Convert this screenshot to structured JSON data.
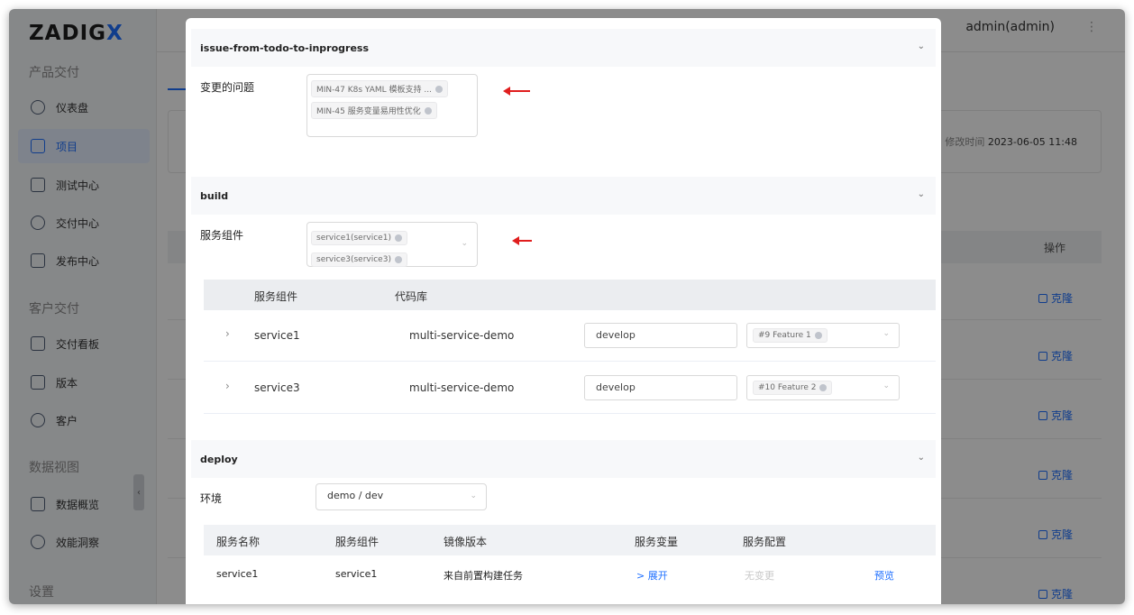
{
  "app": {
    "logo": "ZADIG",
    "logo_x": "X",
    "user": "admin(admin)",
    "more": "⋮"
  },
  "sidebar": {
    "sections": [
      "产品交付",
      "客户交付",
      "数据视图",
      "设置"
    ],
    "items": [
      {
        "label": "仪表盘",
        "icon": "dashboard-icon"
      },
      {
        "label": "项目",
        "icon": "project-icon",
        "active": true
      },
      {
        "label": "测试中心",
        "icon": "test-flask-icon"
      },
      {
        "label": "交付中心",
        "icon": "delivery-icon"
      },
      {
        "label": "发布中心",
        "icon": "release-icon"
      },
      {
        "label": "交付看板",
        "icon": "board-icon"
      },
      {
        "label": "版本",
        "icon": "version-icon"
      },
      {
        "label": "客户",
        "icon": "customer-icon"
      },
      {
        "label": "数据概览",
        "icon": "data-overview-icon"
      },
      {
        "label": "效能洞察",
        "icon": "insight-icon"
      }
    ]
  },
  "background": {
    "modified_label": "修改时间",
    "modified_value": "2023-06-05 11:48",
    "op_header": "操作",
    "clone_label": "克隆"
  },
  "modal": {
    "section1": {
      "title": "issue-from-todo-to-inprogress",
      "field_label": "变更的问题",
      "tags": [
        "MIN-47 K8s YAML 模板支持 ...",
        "MIN-45 服务变量易用性优化"
      ]
    },
    "section2": {
      "title": "build",
      "field_label": "服务组件",
      "tags": [
        "service1(service1)",
        "service3(service3)"
      ],
      "table": {
        "headers": [
          "服务组件",
          "代码库"
        ],
        "rows": [
          {
            "service": "service1",
            "repo": "multi-service-demo",
            "branch": "develop",
            "pr": "#9 Feature 1"
          },
          {
            "service": "service3",
            "repo": "multi-service-demo",
            "branch": "develop",
            "pr": "#10 Feature 2"
          }
        ]
      }
    },
    "section3": {
      "title": "deploy",
      "field_label": "环境",
      "env_value": "demo / dev",
      "table": {
        "headers": [
          "服务名称",
          "服务组件",
          "镜像版本",
          "服务变量",
          "服务配置"
        ],
        "rows": [
          {
            "name": "service1",
            "component": "service1",
            "image": "来自前置构建任务",
            "vars": "> 展开",
            "config": "无变更",
            "preview": "预览"
          }
        ]
      }
    }
  },
  "colors": {
    "accent": "#1e6fff",
    "arrow": "#e01e1e"
  }
}
